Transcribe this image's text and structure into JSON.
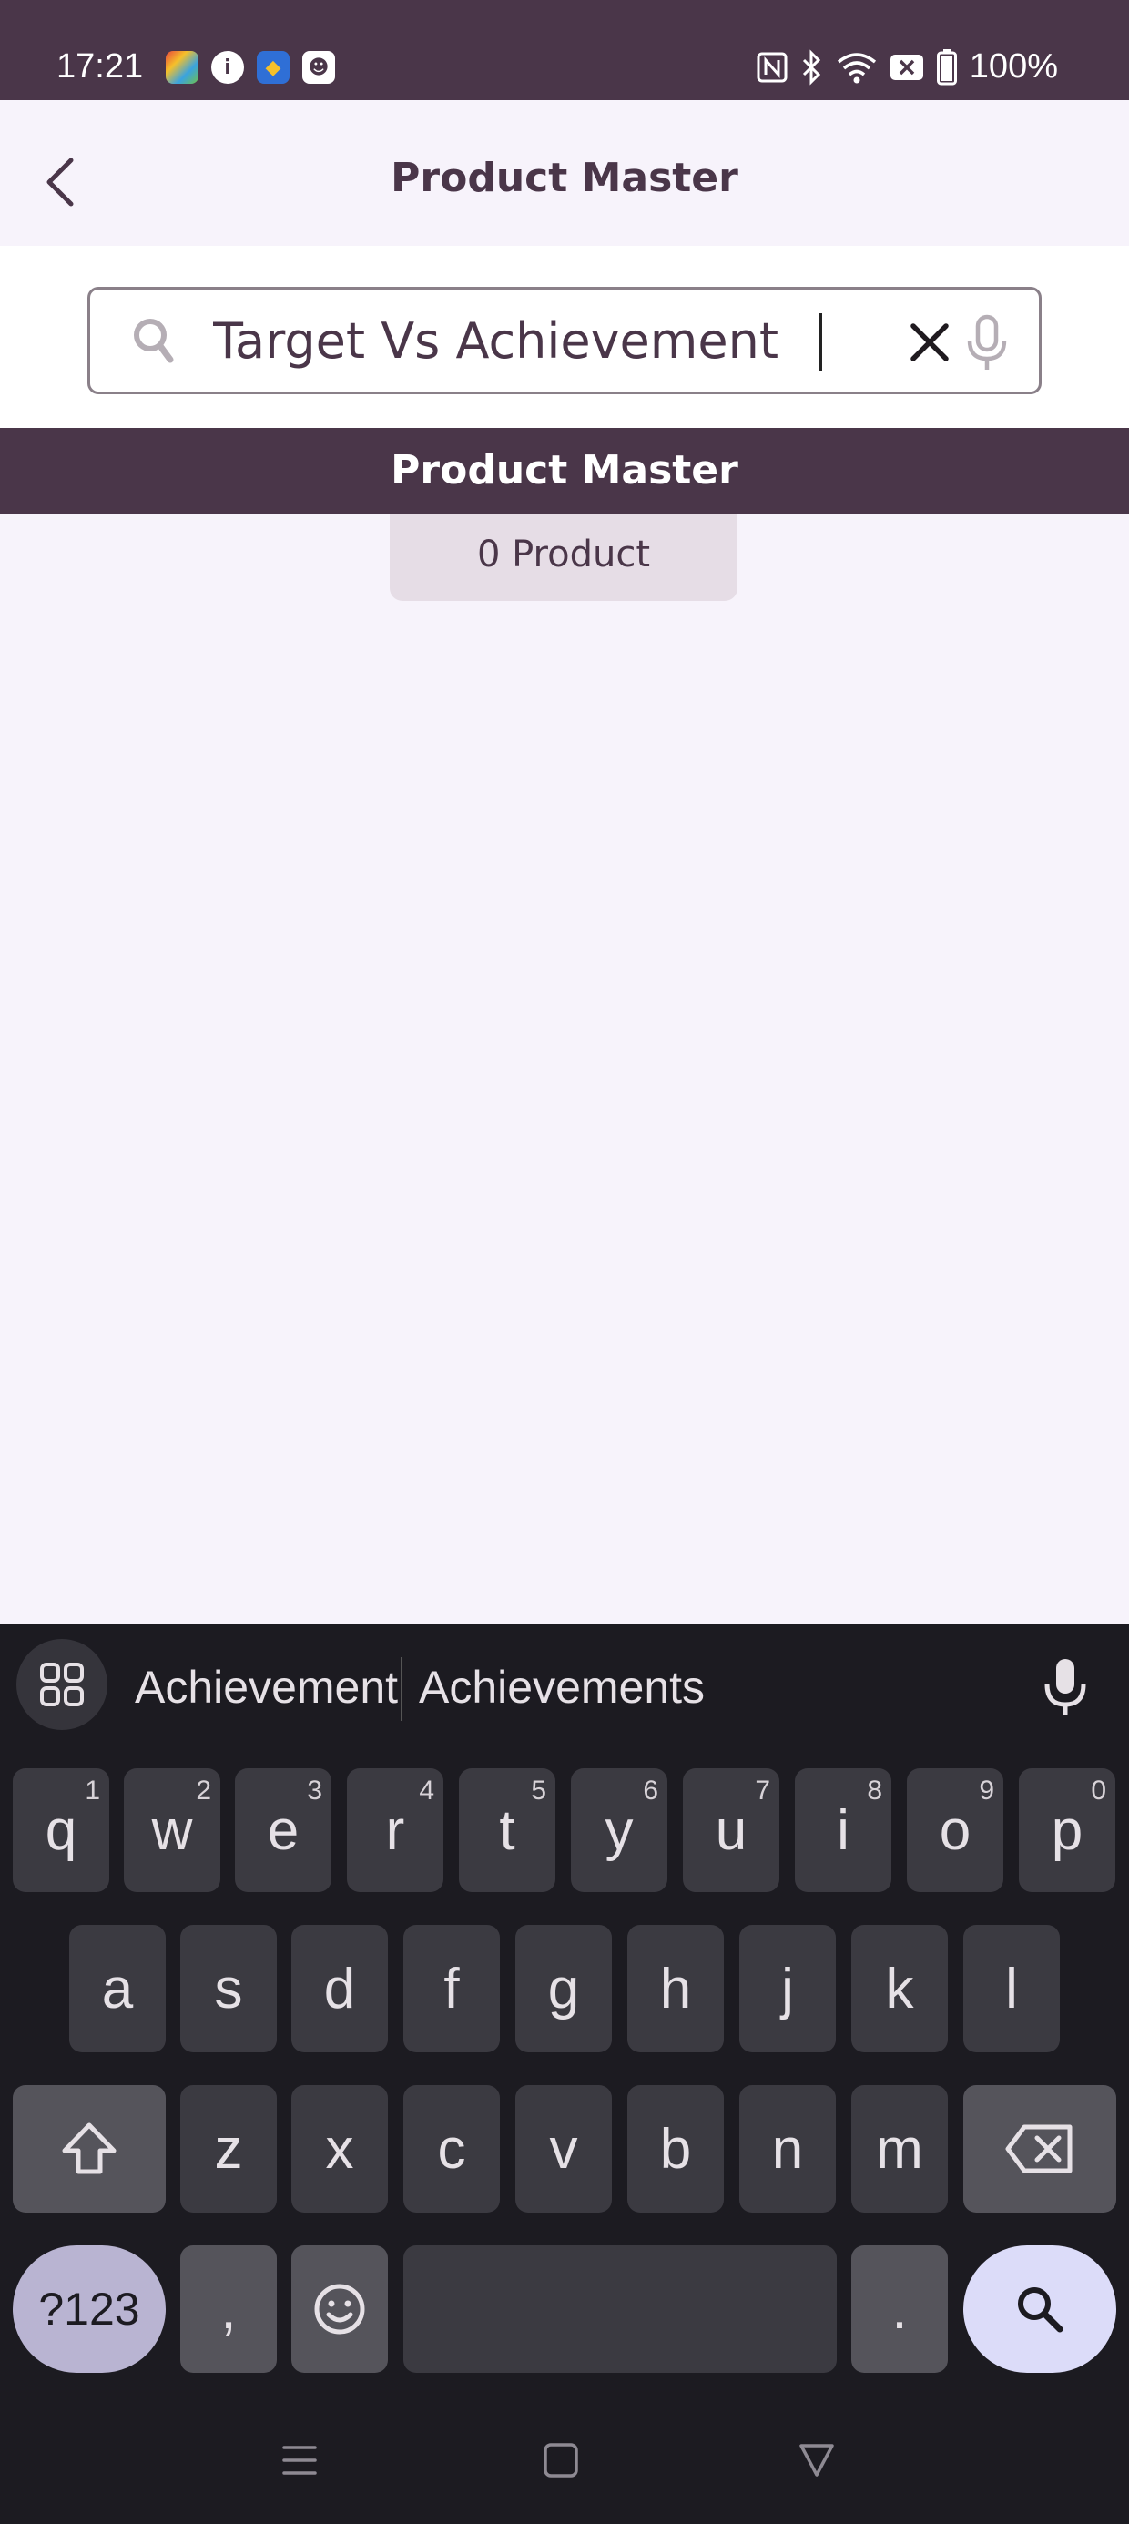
{
  "status_bar": {
    "time": "17:21",
    "battery": "100%",
    "icons": [
      "game-app-icon",
      "info-app-icon",
      "shield-app-icon",
      "bot-app-icon",
      "nfc-icon",
      "bluetooth-icon",
      "wifi-icon",
      "no-sim-icon",
      "battery-icon"
    ]
  },
  "header": {
    "title": "Product Master"
  },
  "search": {
    "value": "Target Vs Achievement",
    "placeholder": ""
  },
  "section": {
    "title": "Product Master",
    "count_label": "0 Product"
  },
  "keyboard": {
    "suggestions": [
      "Achievement",
      "Achievements"
    ],
    "row1": [
      {
        "key": "q",
        "num": "1"
      },
      {
        "key": "w",
        "num": "2"
      },
      {
        "key": "e",
        "num": "3"
      },
      {
        "key": "r",
        "num": "4"
      },
      {
        "key": "t",
        "num": "5"
      },
      {
        "key": "y",
        "num": "6"
      },
      {
        "key": "u",
        "num": "7"
      },
      {
        "key": "i",
        "num": "8"
      },
      {
        "key": "o",
        "num": "9"
      },
      {
        "key": "p",
        "num": "0"
      }
    ],
    "row2": [
      "a",
      "s",
      "d",
      "f",
      "g",
      "h",
      "j",
      "k",
      "l"
    ],
    "row3": [
      "z",
      "x",
      "c",
      "v",
      "b",
      "n",
      "m"
    ],
    "symbols_label": "?123",
    "comma_label": ",",
    "period_label": "."
  },
  "colors": {
    "brand": "#4a3649",
    "background": "#f7f3fb",
    "keyboard_bg": "#1c1b21"
  }
}
